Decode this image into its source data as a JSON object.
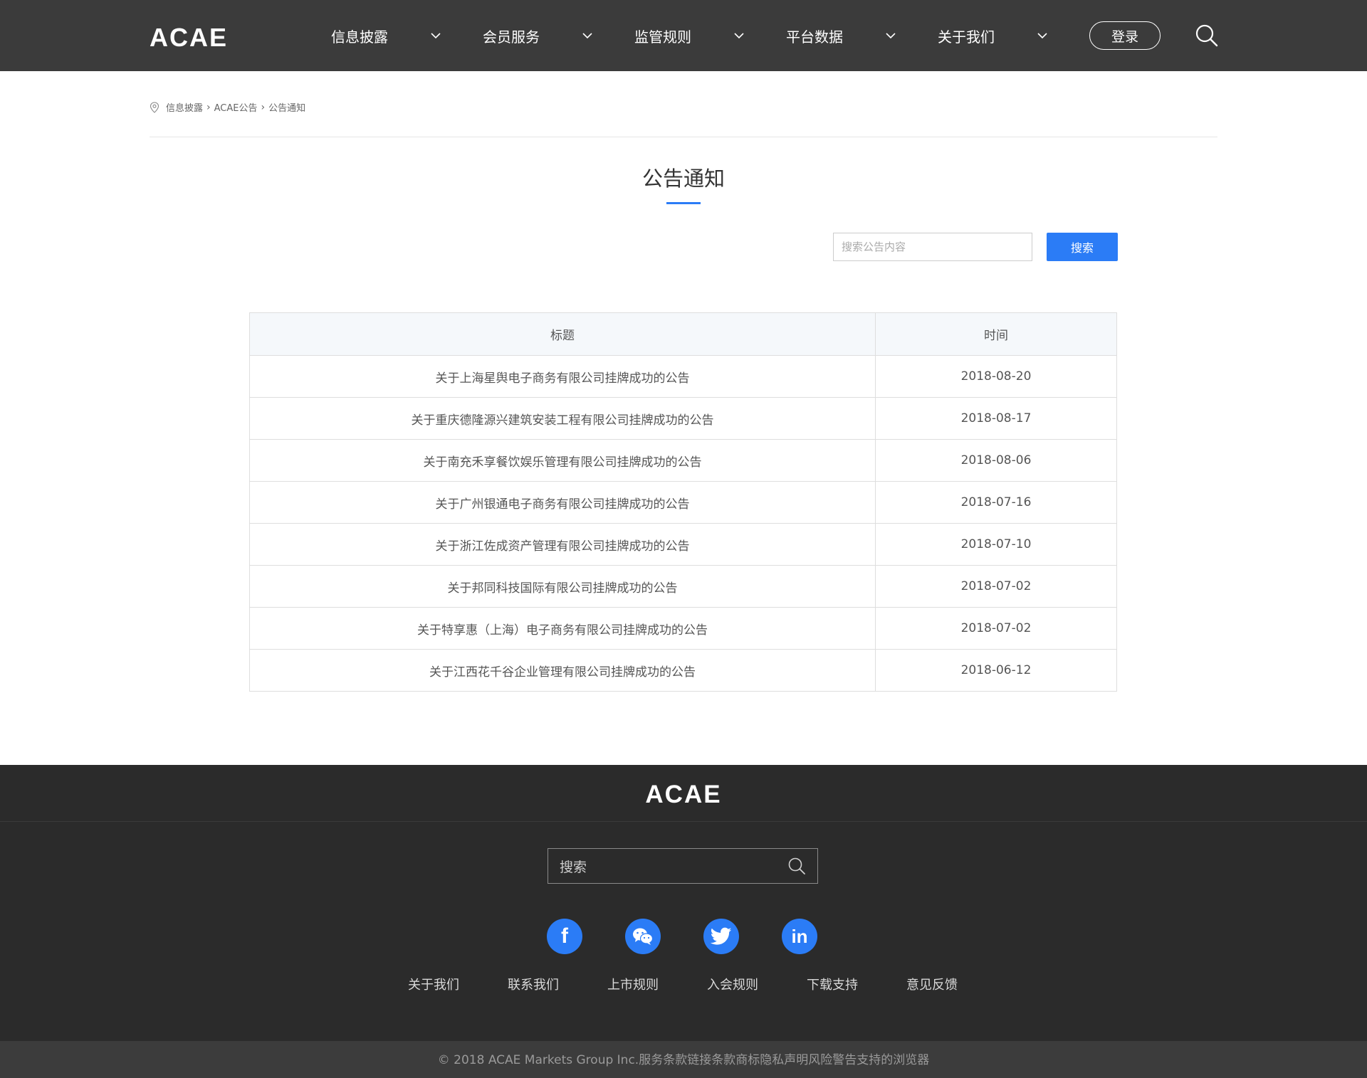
{
  "header": {
    "logo": "ACAE",
    "nav": [
      {
        "label": "信息披露",
        "icon": "chevron-down-icon"
      },
      {
        "label": "会员服务",
        "icon": "chevron-down-icon"
      },
      {
        "label": "监管规则",
        "icon": "chevron-down-icon"
      },
      {
        "label": "平台数据",
        "icon": "chevron-down-icon"
      },
      {
        "label": "关于我们",
        "icon": "chevron-down-icon"
      }
    ],
    "login_label": "登录",
    "search_icon": "search-icon"
  },
  "breadcrumb": {
    "icon": "location-pin-icon",
    "items": [
      "信息披露",
      "ACAE公告",
      "公告通知"
    ]
  },
  "page": {
    "title": "公告通知"
  },
  "search": {
    "placeholder": "搜索公告内容",
    "button_label": "搜索"
  },
  "table": {
    "headers": [
      "标题",
      "时间"
    ],
    "rows": [
      {
        "title": "关于上海星舆电子商务有限公司挂牌成功的公告",
        "date": "2018-08-20"
      },
      {
        "title": "关于重庆德隆源兴建筑安装工程有限公司挂牌成功的公告",
        "date": "2018-08-17"
      },
      {
        "title": "关于南充禾享餐饮娱乐管理有限公司挂牌成功的公告",
        "date": "2018-08-06"
      },
      {
        "title": "关于广州银通电子商务有限公司挂牌成功的公告",
        "date": "2018-07-16"
      },
      {
        "title": "关于浙江佐成资产管理有限公司挂牌成功的公告",
        "date": "2018-07-10"
      },
      {
        "title": "关于邦同科技国际有限公司挂牌成功的公告",
        "date": "2018-07-02"
      },
      {
        "title": "关于特享惠（上海）电子商务有限公司挂牌成功的公告",
        "date": "2018-07-02"
      },
      {
        "title": "关于江西花千谷企业管理有限公司挂牌成功的公告",
        "date": "2018-06-12"
      }
    ]
  },
  "footer": {
    "logo": "ACAE",
    "search_placeholder": "搜索",
    "socials": [
      {
        "name": "facebook-icon",
        "glyph": "f"
      },
      {
        "name": "wechat-icon",
        "glyph": ""
      },
      {
        "name": "twitter-icon",
        "glyph": ""
      },
      {
        "name": "linkedin-icon",
        "glyph": "in"
      }
    ],
    "links": [
      "关于我们",
      "联系我们",
      "上市规则",
      "入会规则",
      "下载支持",
      "意见反馈"
    ],
    "copyright": "© 2018 ACAE Markets Group Inc.服务条款链接条款商标隐私声明风险警告支持的浏览器"
  },
  "colors": {
    "accent": "#2b7cf6",
    "header_bg": "#3b3b3b",
    "footer_bg": "#2b2b2b"
  }
}
